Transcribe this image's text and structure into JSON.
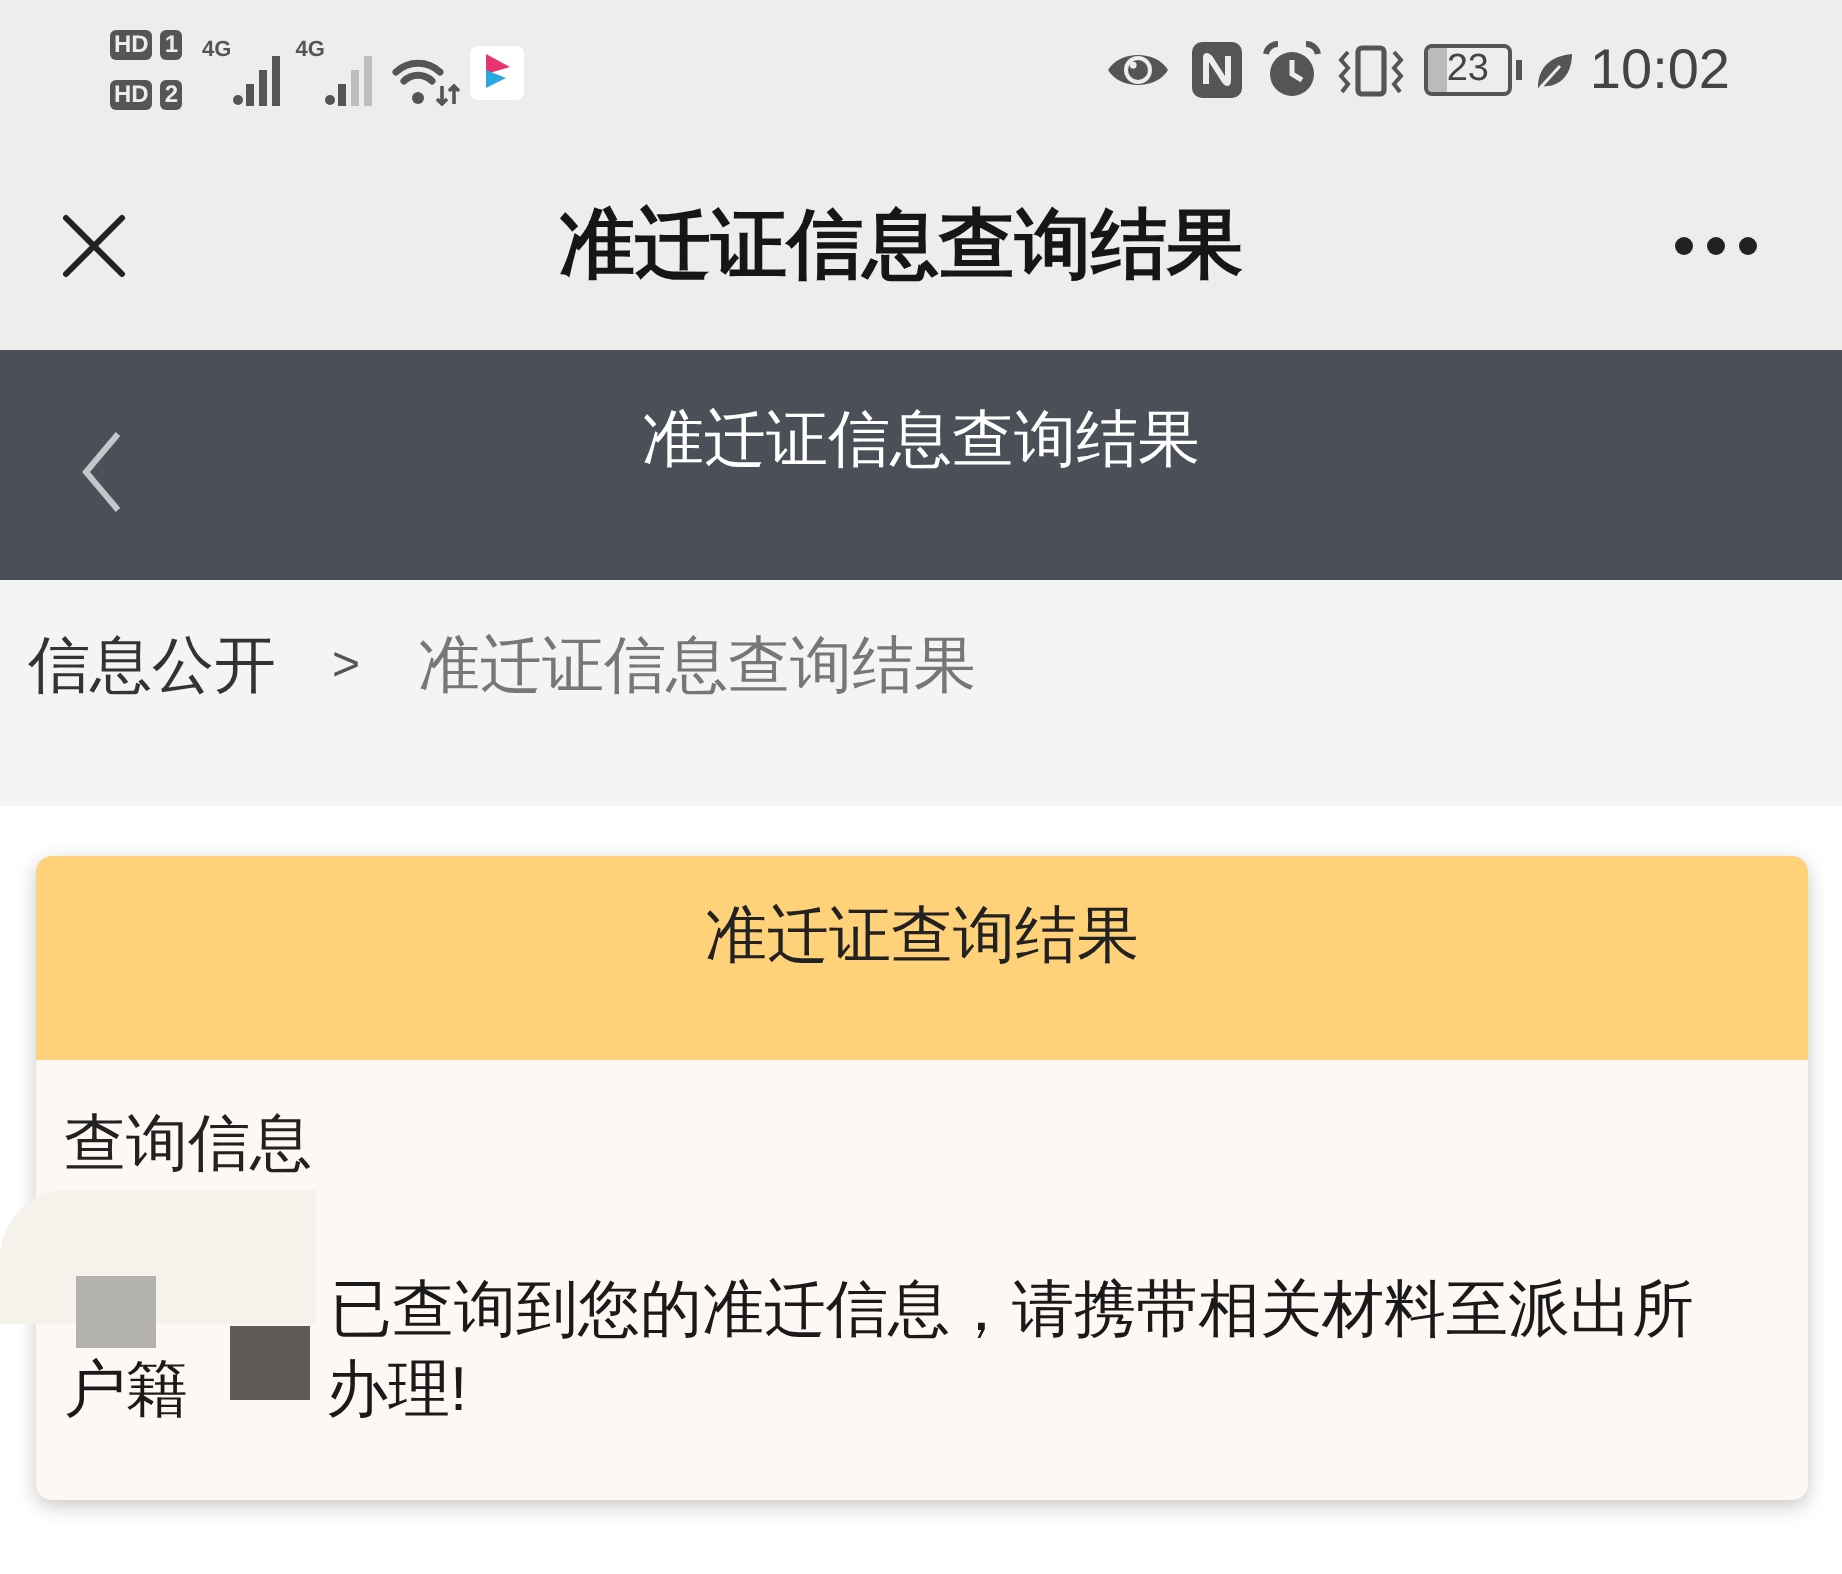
{
  "status_bar": {
    "sims": [
      {
        "label": "HD",
        "slot": "1"
      },
      {
        "label": "HD",
        "slot": "2"
      }
    ],
    "networks": [
      {
        "label": "4G"
      },
      {
        "label": "4G"
      }
    ],
    "battery": "23",
    "time": "10:02"
  },
  "title_bar": {
    "title": "准迁证信息查询结果"
  },
  "header": {
    "title": "准迁证信息查询结果"
  },
  "breadcrumb": {
    "items": [
      "信息公开",
      "准迁证信息查询结果"
    ],
    "separator": ">"
  },
  "result_card": {
    "title": "准迁证查询结果",
    "section_title": "查询信息",
    "message": {
      "first_line": "已查询到您的准迁信息，请携带相关材料至派出所",
      "second_line_start": "户籍",
      "second_line_end": "办理!"
    }
  }
}
